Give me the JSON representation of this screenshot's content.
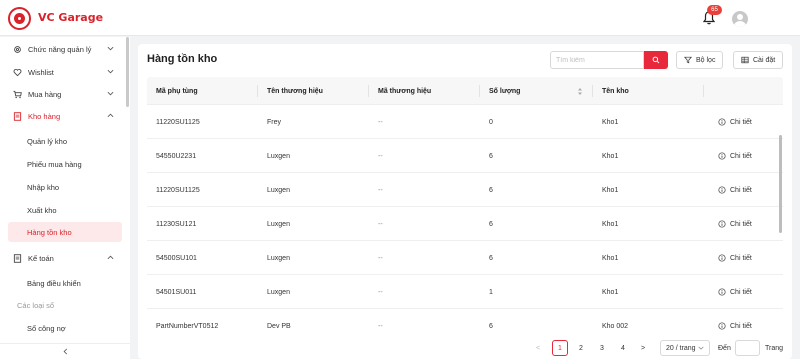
{
  "header": {
    "brand": "VC Garage",
    "notification_count": "65",
    "colors": {
      "brand": "#d9222a",
      "badge": "#e8413b"
    }
  },
  "sidebar": {
    "items": [
      {
        "label": "Chức năng quản lý",
        "icon": "gear-icon"
      },
      {
        "label": "Wishlist",
        "icon": "heart-icon"
      },
      {
        "label": "Mua hàng",
        "icon": "cart-icon"
      },
      {
        "label": "Kho hàng",
        "icon": "document-icon"
      },
      {
        "label": "Kế toán",
        "icon": "book-icon"
      }
    ],
    "warehouse_sub": [
      "Quản lý kho",
      "Phiếu mua hàng",
      "Nhập kho",
      "Xuất kho",
      "Hàng tồn kho"
    ],
    "accounting_sub": [
      "Bảng điều khiển"
    ],
    "group_label": "Các loại sổ",
    "ledger_sub": [
      "Sổ công nợ"
    ]
  },
  "main": {
    "title": "Hàng tồn kho",
    "search_placeholder": "Tìm kiếm",
    "filter_label": "Bộ lọc",
    "settings_label": "Cài đặt",
    "columns": [
      "Mã phụ tùng",
      "Tên thương hiệu",
      "Mã thương hiệu",
      "Số lượng",
      "Tên kho",
      ""
    ],
    "detail_label": "Chi tiết",
    "rows": [
      [
        "11220SU1125",
        "Frey",
        "--",
        "0",
        "Kho1"
      ],
      [
        "54550U2231",
        "Luxgen",
        "--",
        "6",
        "Kho1"
      ],
      [
        "11220SU1125",
        "Luxgen",
        "--",
        "6",
        "Kho1"
      ],
      [
        "11230SU121",
        "Luxgen",
        "--",
        "6",
        "Kho1"
      ],
      [
        "54500SU101",
        "Luxgen",
        "--",
        "6",
        "Kho1"
      ],
      [
        "54501SU011",
        "Luxgen",
        "--",
        "1",
        "Kho1"
      ],
      [
        "PartNumberVT0512",
        "Dev PB",
        "--",
        "6",
        "Kho 002"
      ]
    ]
  },
  "pagination": {
    "prev": "<",
    "pages": [
      "1",
      "2",
      "3",
      "4"
    ],
    "next": ">",
    "page_size": "20 / trang",
    "goto_label": "Đến",
    "goto_suffix": "Trang"
  }
}
